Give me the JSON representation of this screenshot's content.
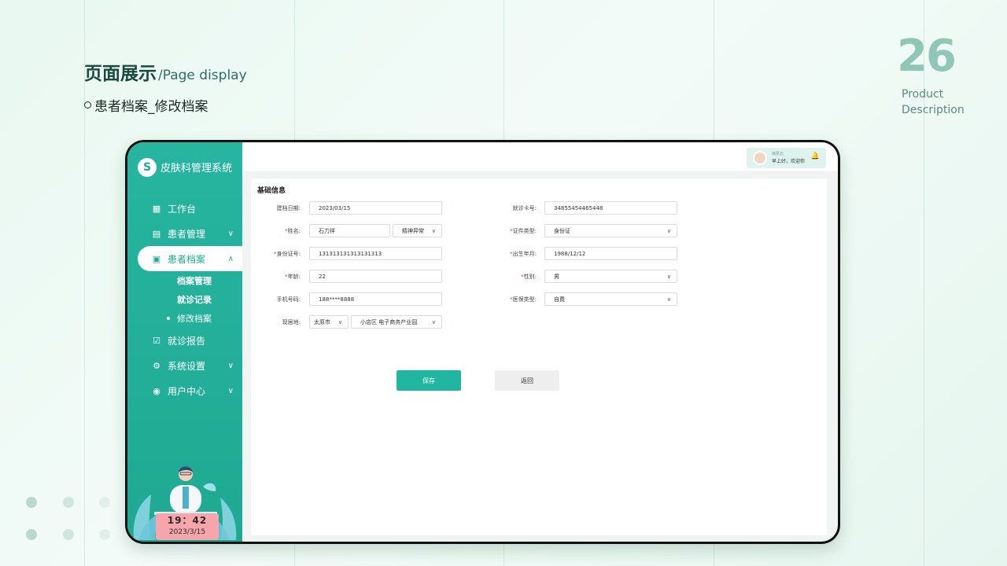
{
  "slide": {
    "title_cn": "页面展示",
    "title_en": "/Page display",
    "subtitle": "患者档案_修改档案",
    "page_number": "26",
    "page_label_1": "Product",
    "page_label_2": "Description"
  },
  "app": {
    "name": "皮肤科管理系统",
    "logo_glyph": "S"
  },
  "sidebar": {
    "items": [
      {
        "label": "工作台",
        "icon": "grid-icon"
      },
      {
        "label": "患者管理",
        "icon": "list-icon"
      },
      {
        "label": "患者档案",
        "icon": "archive-icon"
      },
      {
        "label": "就诊报告",
        "icon": "report-icon"
      },
      {
        "label": "系统设置",
        "icon": "gear-icon"
      },
      {
        "label": "用户中心",
        "icon": "user-icon"
      }
    ],
    "subitems": [
      "档案管理",
      "就诊记录",
      "修改档案"
    ],
    "clock_time": "19：42",
    "clock_date": "2023/3/15"
  },
  "header": {
    "user_name": "梅慧云",
    "greeting": "早上好，欢迎你"
  },
  "form": {
    "section_title": "基础信息",
    "left": [
      {
        "label": "建档日期:",
        "value": "2023/03/15",
        "required": false
      },
      {
        "label": "姓名:",
        "value": "石力祥",
        "required": true,
        "extra_value": "精神异常"
      },
      {
        "label": "身份证号:",
        "value": "131313131313131313",
        "required": true
      },
      {
        "label": "年龄:",
        "value": "22",
        "required": true
      },
      {
        "label": "手机号码:",
        "value": "188****8888",
        "required": false
      },
      {
        "label": "现居地:",
        "value": "太原市",
        "required": false,
        "extra_value": "小店区 电子商务产业园"
      }
    ],
    "right": [
      {
        "label": "就诊卡号:",
        "value": "34855454465448",
        "required": false
      },
      {
        "label": "证件类型:",
        "value": "身份证",
        "required": true
      },
      {
        "label": "出生年月:",
        "value": "1988/12/12",
        "required": true
      },
      {
        "label": "性别:",
        "value": "男",
        "required": true
      },
      {
        "label": "医保类型:",
        "value": "自费",
        "required": true
      }
    ],
    "save_label": "保存",
    "back_label": "返回"
  },
  "colors": {
    "accent": "#21b69f",
    "sidebar": "#27b5a0",
    "required": "#e33333",
    "page_number": "#8fc6b5"
  }
}
